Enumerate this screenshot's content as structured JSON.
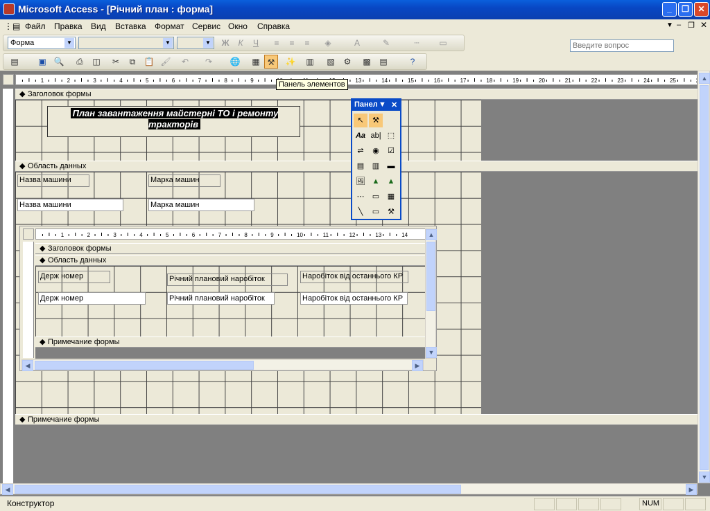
{
  "app": {
    "title": "Microsoft Access - [Річний план : форма]"
  },
  "menu": [
    "Файл",
    "Правка",
    "Вид",
    "Вставка",
    "Формат",
    "Сервис",
    "Окно",
    "Справка"
  ],
  "ask": {
    "placeholder": "Введите вопрос"
  },
  "toolbar": {
    "object_combo": "Форма",
    "font_combo": "",
    "size_combo": "",
    "bold": "Ж",
    "italic": "К",
    "underline": "Ч"
  },
  "tooltip": "Панель элементов",
  "ruler": {
    "ticks": [
      "1",
      "2",
      "3",
      "4",
      "5",
      "6",
      "7",
      "8",
      "9",
      "10",
      "11",
      "12",
      "13",
      "14",
      "15",
      "16",
      "17",
      "18",
      "19",
      "20",
      "21",
      "22",
      "23",
      "24",
      "25",
      "2"
    ]
  },
  "form": {
    "header_label": "Заголовок формы",
    "title_text": "План завантаження майстерні ТО і ремонту тракторів",
    "detail_label": "Область данных",
    "label1": "Назва машини",
    "label2": "Марка машин",
    "field1": "Назва машини",
    "field2": "Марка машин",
    "footer_label": "Примечание формы"
  },
  "subform": {
    "header_label": "Заголовок формы",
    "detail_label": "Область данных",
    "footer_label": "Примечание формы",
    "label1": "Держ номер",
    "label2": "Річний плановий наробіток",
    "label3": "Наробіток від останнього КР",
    "field1": "Держ номер",
    "field2": "Річний плановий наробіток",
    "field3": "Наробіток від останнього КР",
    "ruler_ticks": [
      "1",
      "2",
      "3",
      "4",
      "5",
      "6",
      "7",
      "8",
      "9",
      "10",
      "11",
      "12",
      "13",
      "14"
    ]
  },
  "palette": {
    "title": "Панел"
  },
  "status": {
    "mode": "Конструктор",
    "num": "NUM"
  }
}
